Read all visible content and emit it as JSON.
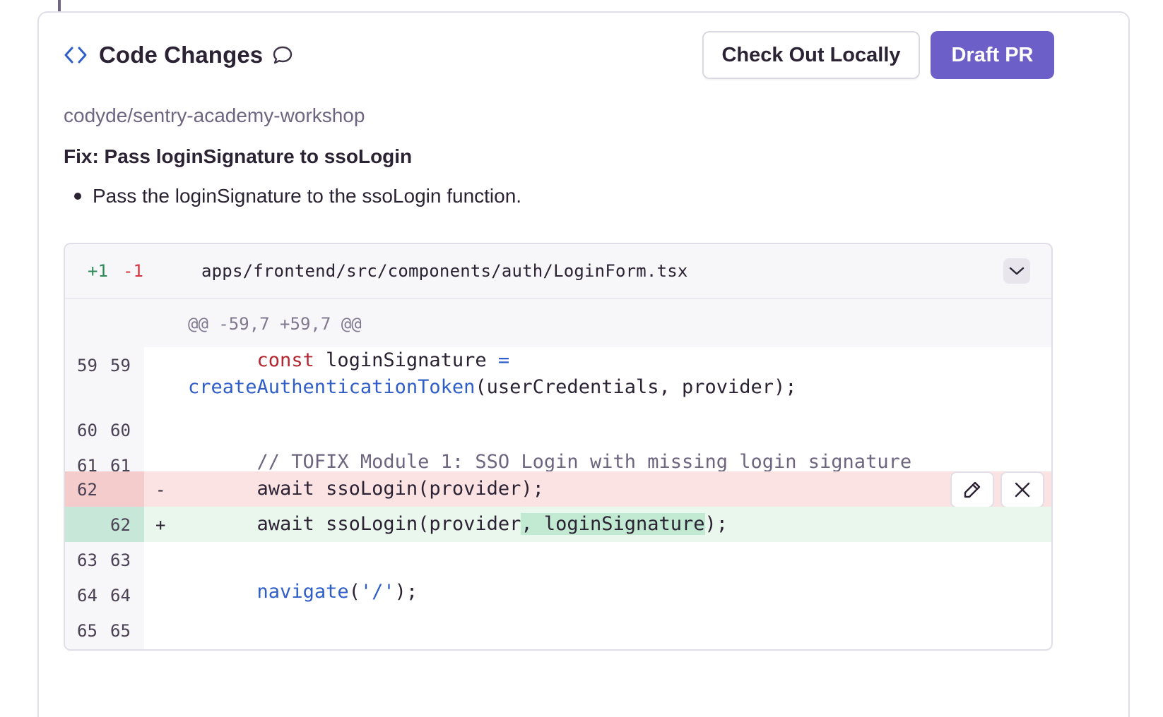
{
  "panel": {
    "title": "Code Changes",
    "repo": "codyde/sentry-academy-workshop",
    "fix_title": "Fix: Pass loginSignature to ssoLogin",
    "bullets": [
      "Pass the loginSignature to the ssoLogin function."
    ],
    "buttons": {
      "checkout": "Check Out Locally",
      "draft": "Draft PR"
    }
  },
  "diff": {
    "added": "+1",
    "removed": "-1",
    "file": "apps/frontend/src/components/auth/LoginForm.tsx",
    "hunk": "@@ -59,7 +59,7 @@",
    "lines": [
      {
        "old": "59",
        "new": "59",
        "sign": "",
        "kind": "context",
        "parts": [
          {
            "t": "      ",
            "c": ""
          },
          {
            "t": "const",
            "c": "kw"
          },
          {
            "t": " loginSignature ",
            "c": ""
          },
          {
            "t": "=",
            "c": "op"
          }
        ],
        "parts2": [
          {
            "t": "createAuthenticationToken",
            "c": "fn"
          },
          {
            "t": "(userCredentials, provider);",
            "c": ""
          }
        ]
      },
      {
        "old": "60",
        "new": "60",
        "sign": "",
        "kind": "context",
        "parts": []
      },
      {
        "old": "61",
        "new": "61",
        "sign": "",
        "kind": "context",
        "parts": [
          {
            "t": "      // TOFIX Module 1: SSO Login with missing login signature",
            "c": "cm"
          }
        ]
      },
      {
        "old": "62",
        "new": "",
        "sign": "-",
        "kind": "removed",
        "parts": [
          {
            "t": "      await ssoLogin(provider);",
            "c": ""
          }
        ]
      },
      {
        "old": "",
        "new": "62",
        "sign": "+",
        "kind": "added",
        "parts": [
          {
            "t": "      await ssoLogin(provider",
            "c": ""
          },
          {
            "t": ", loginSignature",
            "c": "hl-add"
          },
          {
            "t": ");",
            "c": ""
          }
        ]
      },
      {
        "old": "63",
        "new": "63",
        "sign": "",
        "kind": "context",
        "parts": []
      },
      {
        "old": "64",
        "new": "64",
        "sign": "",
        "kind": "context",
        "parts": [
          {
            "t": "      ",
            "c": ""
          },
          {
            "t": "navigate",
            "c": "fn"
          },
          {
            "t": "(",
            "c": ""
          },
          {
            "t": "'/'",
            "c": "str"
          },
          {
            "t": ");",
            "c": ""
          }
        ]
      },
      {
        "old": "65",
        "new": "65",
        "sign": "",
        "kind": "context",
        "parts": []
      }
    ]
  },
  "icons": {
    "title_icon": "code-brackets-icon",
    "comment_icon": "comment-icon",
    "collapse_icon": "chevron-down-icon",
    "edit_icon": "pencil-icon",
    "close_icon": "close-icon"
  },
  "colors": {
    "accent": "#6c5fc7",
    "added_bg": "#eaf7ec",
    "removed_bg": "#fbe3e4",
    "added_text": "#2b8a55",
    "removed_text": "#d1343c"
  }
}
